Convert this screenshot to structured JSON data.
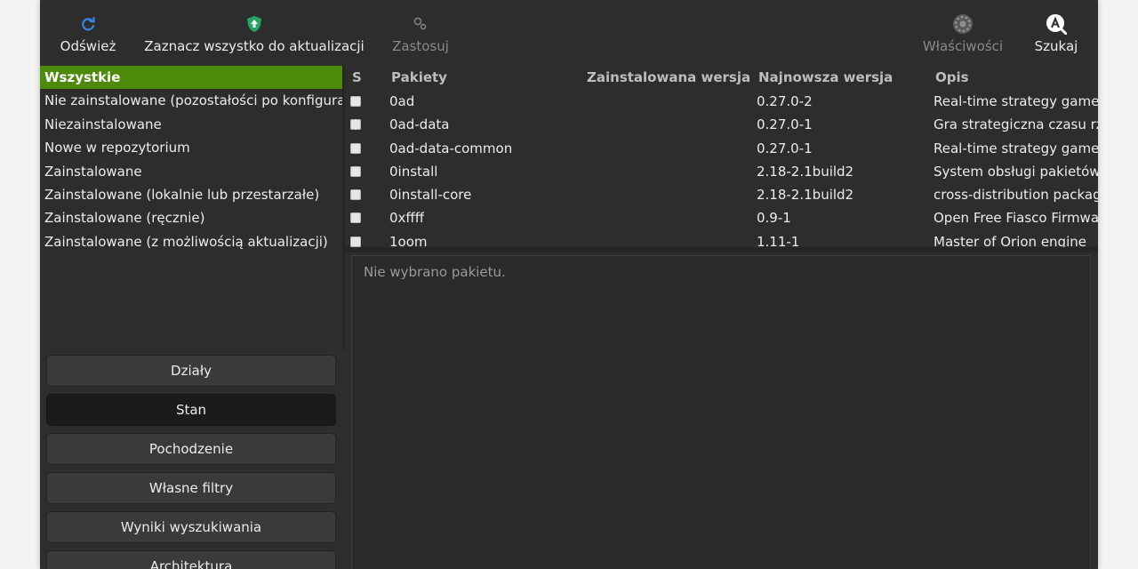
{
  "toolbar": {
    "refresh_label": "Odśwież",
    "mark_all_label": "Zaznacz wszystko do aktualizacji",
    "apply_label": "Zastosuj",
    "properties_label": "Właściwości",
    "search_label": "Szukaj",
    "icons": {
      "refresh": "refresh-icon",
      "mark_all": "shield-upgrade-icon",
      "apply": "apply-icon",
      "properties": "gear-icon",
      "search": "search-icon"
    },
    "colors": {
      "refresh": "#3584e4",
      "mark_all": "#26a269"
    }
  },
  "filters": {
    "items": [
      {
        "label": "Wszystkie",
        "selected": true
      },
      {
        "label": "Nie zainstalowane (pozostałości po konfiguracji)"
      },
      {
        "label": "Niezainstalowane"
      },
      {
        "label": "Nowe w repozytorium"
      },
      {
        "label": "Zainstalowane"
      },
      {
        "label": "Zainstalowane (lokalnie lub przestarzałe)"
      },
      {
        "label": "Zainstalowane (ręcznie)"
      },
      {
        "label": "Zainstalowane (z możliwością aktualizacji)"
      }
    ],
    "selected_color": "#4e8a0a"
  },
  "side_buttons": [
    {
      "label": "Działy"
    },
    {
      "label": "Stan",
      "active": true
    },
    {
      "label": "Pochodzenie"
    },
    {
      "label": "Własne filtry"
    },
    {
      "label": "Wyniki wyszukiwania"
    },
    {
      "label": "Architektura"
    }
  ],
  "table": {
    "headers": {
      "status": "S",
      "package": "Pakiety",
      "installed": "Zainstalowana wersja",
      "latest": "Najnowsza wersja",
      "description": "Opis"
    },
    "rows": [
      {
        "package": "0ad",
        "installed": "",
        "latest": "0.27.0-2",
        "description": "Real-time strategy game of ancient warfare"
      },
      {
        "package": "0ad-data",
        "installed": "",
        "latest": "0.27.0-1",
        "description": "Gra strategiczna czasu rzeczywistego"
      },
      {
        "package": "0ad-data-common",
        "installed": "",
        "latest": "0.27.0-1",
        "description": "Real-time strategy game of ancient warfare"
      },
      {
        "package": "0install",
        "installed": "",
        "latest": "2.18-2.1build2",
        "description": "System obsługi pakietów, niezależny od dystrybucji"
      },
      {
        "package": "0install-core",
        "installed": "",
        "latest": "2.18-2.1build2",
        "description": "cross-distribution packaging system"
      },
      {
        "package": "0xffff",
        "installed": "",
        "latest": "0.9-1",
        "description": "Open Free Fiasco Firmware Flasher"
      },
      {
        "package": "1oom",
        "installed": "",
        "latest": "1.11-1",
        "description": "Master of Orion engine"
      }
    ]
  },
  "details": {
    "message": "Nie wybrano pakietu."
  }
}
